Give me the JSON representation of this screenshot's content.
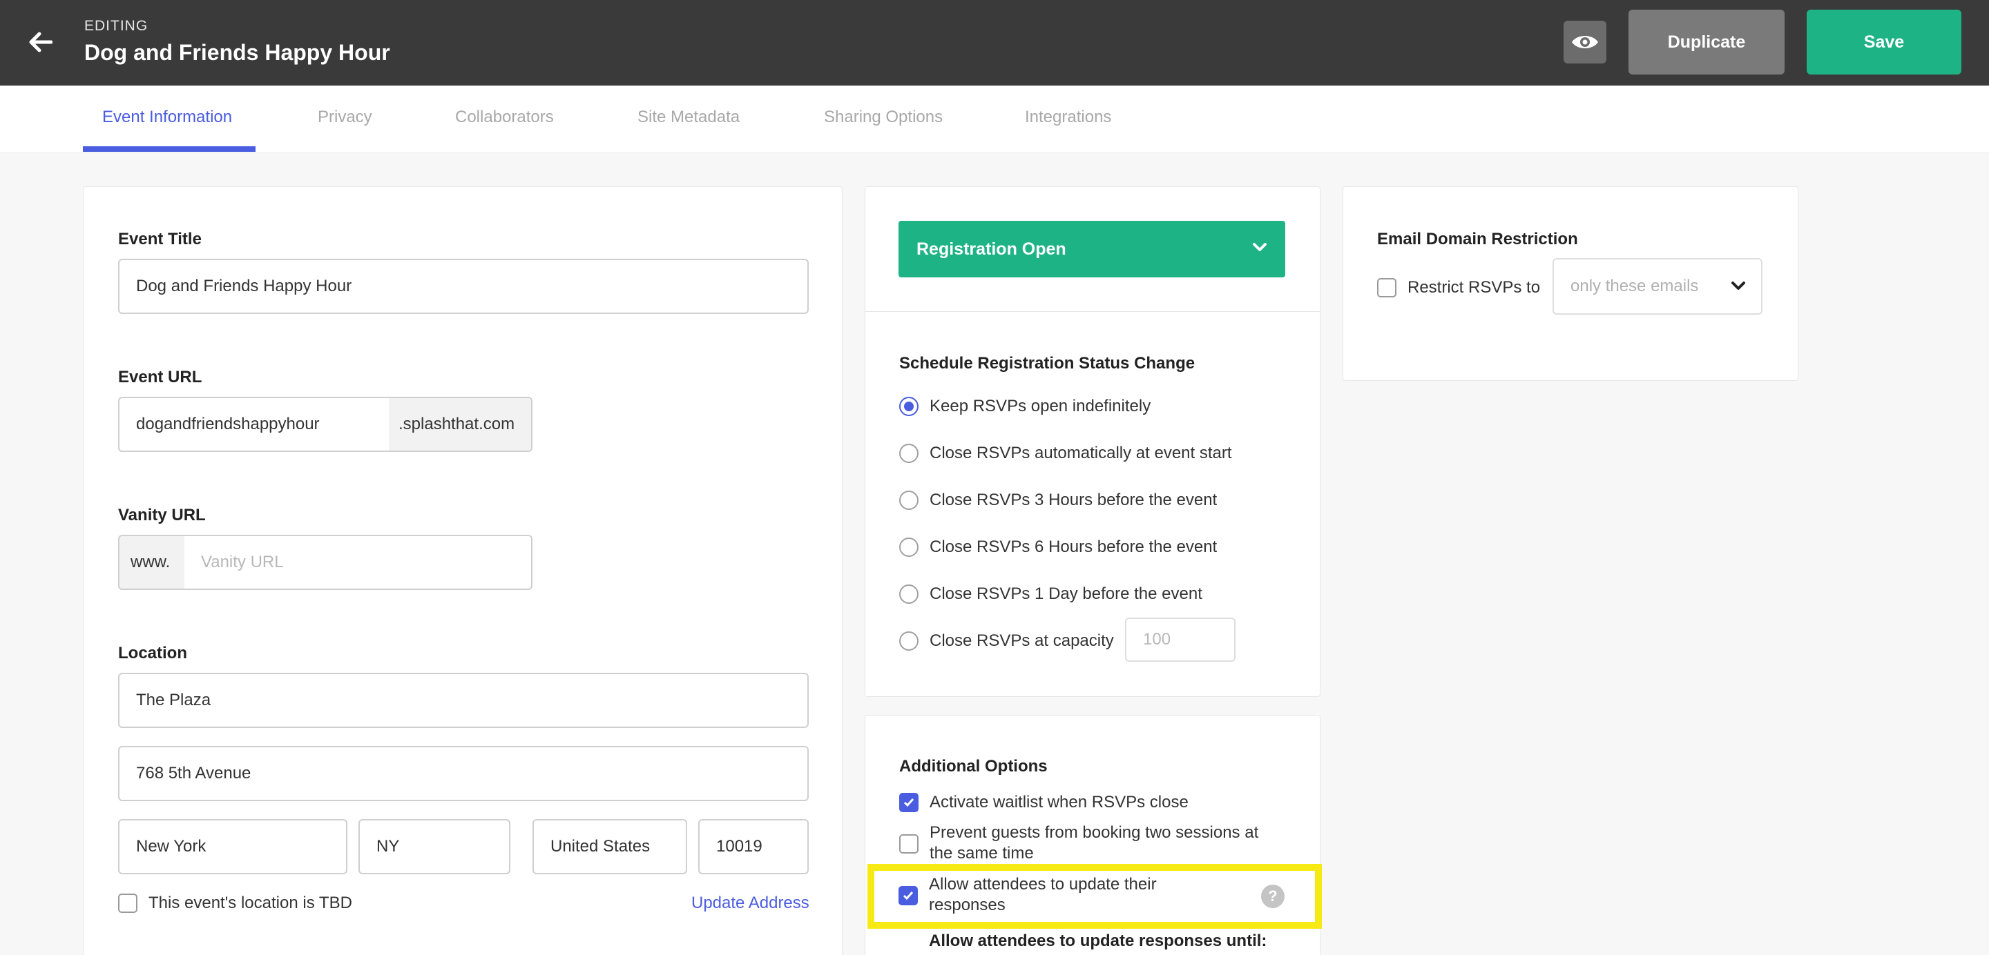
{
  "header": {
    "editing_label": "EDITING",
    "event_name": "Dog and Friends Happy Hour",
    "duplicate_label": "Duplicate",
    "save_label": "Save"
  },
  "tabs": [
    {
      "label": "Event Information",
      "active": true
    },
    {
      "label": "Privacy"
    },
    {
      "label": "Collaborators"
    },
    {
      "label": "Site Metadata"
    },
    {
      "label": "Sharing Options"
    },
    {
      "label": "Integrations"
    }
  ],
  "event_info": {
    "title_label": "Event Title",
    "title_value": "Dog and Friends Happy Hour",
    "url_label": "Event URL",
    "url_value": "dogandfriendshappyhour",
    "url_suffix": ".splashthat.com",
    "vanity_label": "Vanity URL",
    "vanity_prefix": "www.",
    "vanity_placeholder": "Vanity URL",
    "location_label": "Location",
    "venue": "The Plaza",
    "street": "768 5th Avenue",
    "city": "New York",
    "state": "NY",
    "country": "United States",
    "zip": "10019",
    "tbd_label": "This event's location is TBD",
    "update_address_label": "Update Address"
  },
  "registration": {
    "status": "Registration Open",
    "schedule_title": "Schedule Registration Status Change",
    "options": [
      "Keep RSVPs open indefinitely",
      "Close RSVPs automatically at event start",
      "Close RSVPs 3 Hours before the event",
      "Close RSVPs 6 Hours before the event",
      "Close RSVPs 1 Day before the event",
      "Close RSVPs at capacity"
    ],
    "capacity_placeholder": "100"
  },
  "additional": {
    "title": "Additional Options",
    "waitlist": "Activate waitlist when RSVPs close",
    "prevent_line1": "Prevent guests from booking two sessions at",
    "prevent_line2": "the same time",
    "allow_line1": "Allow attendees to update their",
    "allow_line2": "responses",
    "help_glyph": "?",
    "until_label": "Allow attendees to update responses until:"
  },
  "email_restriction": {
    "title": "Email Domain Restriction",
    "restrict_label": "Restrict RSVPs to",
    "select_value": "only these emails"
  },
  "colors": {
    "accent": "#4a5ce0",
    "success": "#1db385",
    "header_bg": "#3a3a3a",
    "highlight": "#f7ea14"
  }
}
